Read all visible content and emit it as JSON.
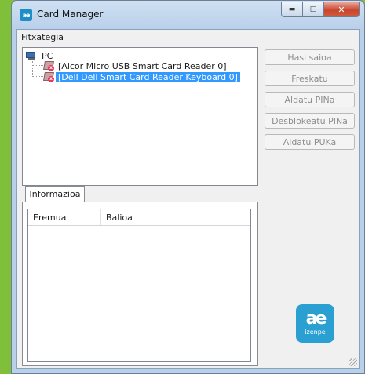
{
  "window": {
    "title": "Card Manager",
    "icon": "izenpe-app-icon",
    "controls": [
      "minimize-icon",
      "maximize-icon",
      "close-icon"
    ]
  },
  "menu": {
    "items": [
      "Fitxategia"
    ]
  },
  "tree": {
    "root": "PC",
    "children": [
      {
        "label": "[Alcor Micro USB Smart Card Reader 0]",
        "icon": "card-reader-error-icon",
        "selected": false
      },
      {
        "label": "[Dell Dell Smart Card Reader Keyboard 0]",
        "icon": "card-reader-error-icon",
        "selected": true
      }
    ]
  },
  "actions": [
    "Hasi saioa",
    "Freskatu",
    "Aldatu PINa",
    "Desblokeatu PINa",
    "Aldatu PUKa"
  ],
  "info_tab": {
    "label": "Informazioa",
    "columns": [
      "Eremua",
      "Balioa"
    ],
    "rows": []
  },
  "logo": {
    "text": "izenpe",
    "mark": "ae"
  },
  "colors": {
    "selection": "#3399ff",
    "logo": "#2a9fd2",
    "close_button": "#c9452d"
  }
}
